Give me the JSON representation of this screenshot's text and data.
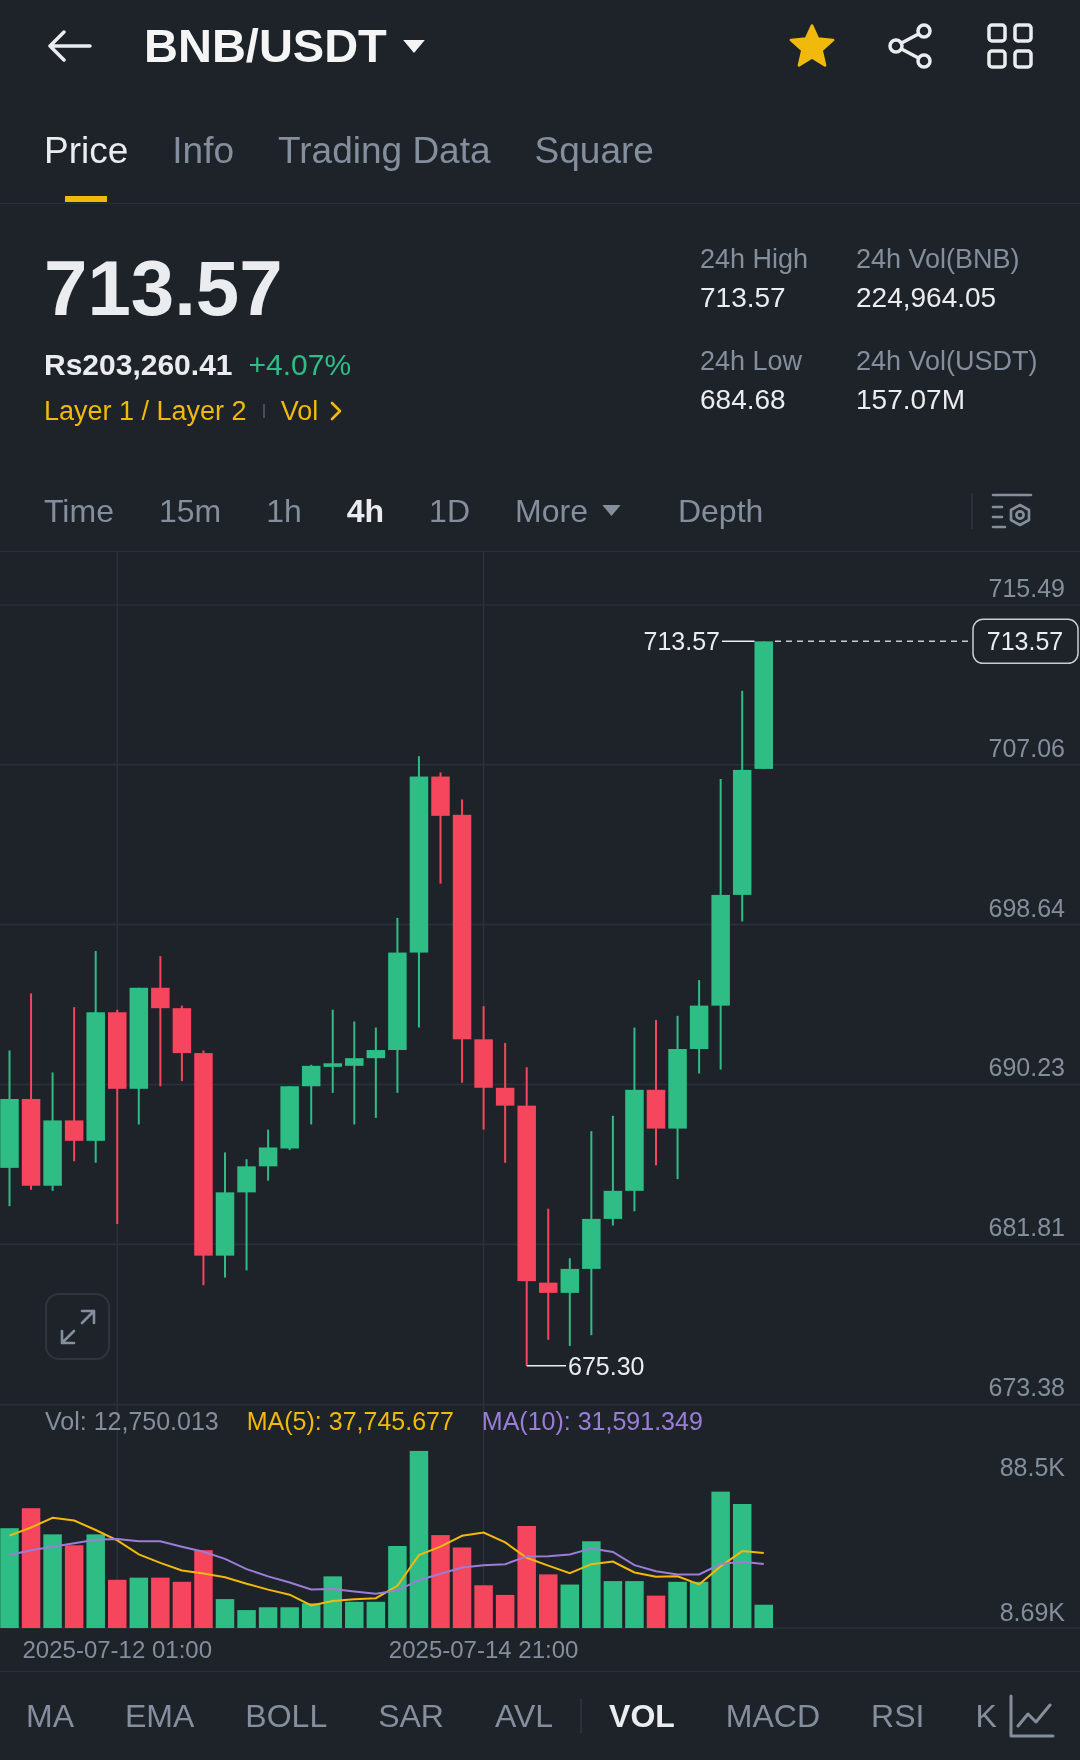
{
  "header": {
    "title": "BNB/USDT",
    "favorite": true
  },
  "tabs": [
    {
      "label": "Price",
      "selected": true
    },
    {
      "label": "Info",
      "selected": false
    },
    {
      "label": "Trading Data",
      "selected": false
    },
    {
      "label": "Square",
      "selected": false
    }
  ],
  "ticker": {
    "price": "713.57",
    "fiat_price": "Rs203,260.41",
    "change": "+4.07%",
    "tags": [
      {
        "label": "Layer 1 / Layer 2",
        "kind": "category"
      },
      {
        "label": "Vol",
        "kind": "link"
      }
    ]
  },
  "stats": [
    {
      "label": "24h High",
      "value": "713.57"
    },
    {
      "label": "24h Vol(BNB)",
      "value": "224,964.05"
    },
    {
      "label": "24h Low",
      "value": "684.68"
    },
    {
      "label": "24h Vol(USDT)",
      "value": "157.07M"
    }
  ],
  "intervals": [
    {
      "label": "Time",
      "kind": "tab",
      "selected": false
    },
    {
      "label": "15m",
      "kind": "tab",
      "selected": false
    },
    {
      "label": "1h",
      "kind": "tab",
      "selected": false
    },
    {
      "label": "4h",
      "kind": "tab",
      "selected": true
    },
    {
      "label": "1D",
      "kind": "tab",
      "selected": false
    },
    {
      "label": "More",
      "kind": "dropdown",
      "selected": false
    },
    {
      "label": "Depth",
      "kind": "tab",
      "selected": false
    }
  ],
  "price_chart": {
    "axis_labels": [
      "715.49",
      "707.06",
      "698.64",
      "690.23",
      "681.81",
      "673.38"
    ],
    "last_price": "713.57",
    "high_label": "713.57",
    "low_label": "675.30"
  },
  "volume_chart": {
    "legend": [
      {
        "label": "Vol: 12,750.013",
        "color": "#848e9c"
      },
      {
        "label": "MA(5): 37,745.677",
        "color": "#f0b90b"
      },
      {
        "label": "MA(10): 31,591.349",
        "color": "#9b7dd8"
      }
    ],
    "chart_data": {
      "type": "bar",
      "ylim": [
        0,
        123200
      ],
      "yticks": [
        {
          "value": 88500,
          "label": "88.5K"
        },
        {
          "value": 8690,
          "label": "8.69K"
        }
      ],
      "categories": [
        null,
        null,
        null,
        null,
        null,
        "2025-07-12 01:00",
        null,
        null,
        null,
        null,
        null,
        null,
        null,
        null,
        null,
        null,
        null,
        null,
        null,
        null,
        null,
        null,
        "2025-07-14 21:00",
        null,
        null,
        null,
        null,
        null,
        null,
        null,
        null,
        null,
        null,
        null,
        null,
        null
      ],
      "series": [
        {
          "type": "bar",
          "colors": [
            "#2ebd85",
            "#f6465d",
            "#2ebd85",
            "#f6465d",
            "#2ebd85",
            "#f6465d",
            "#2ebd85",
            "#f6465d",
            "#f6465d",
            "#f6465d",
            "#2ebd85",
            "#2ebd85",
            "#2ebd85",
            "#2ebd85",
            "#2ebd85",
            "#2ebd85",
            "#2ebd85",
            "#2ebd85",
            "#2ebd85",
            "#2ebd85",
            "#f6465d",
            "#f6465d",
            "#f6465d",
            "#f6465d",
            "#f6465d",
            "#f6465d",
            "#2ebd85",
            "#2ebd85",
            "#2ebd85",
            "#2ebd85",
            "#f6465d",
            "#2ebd85",
            "#2ebd85",
            "#2ebd85",
            "#2ebd85",
            "#2ebd85"
          ],
          "values": [
            54900,
            65900,
            51500,
            45500,
            51500,
            26500,
            27700,
            27700,
            25400,
            42800,
            15900,
            9850,
            11400,
            11400,
            13600,
            28400,
            14400,
            14400,
            45100,
            97400,
            51100,
            44300,
            23500,
            18200,
            56100,
            29500,
            23900,
            47700,
            25800,
            25800,
            17800,
            25400,
            25400,
            75000,
            68200,
            12800
          ]
        },
        {
          "type": "line",
          "color": "#f0b90b",
          "values": [
            50800,
            55300,
            60600,
            59100,
            53900,
            48200,
            40500,
            35800,
            31700,
            30000,
            27900,
            24300,
            21100,
            18300,
            12400,
            14900,
            15800,
            16400,
            23200,
            40100,
            44700,
            50700,
            52500,
            47100,
            38600,
            34300,
            30200,
            35100,
            36600,
            30500,
            28200,
            28500,
            24000,
            33900,
            42300,
            41300
          ]
        },
        {
          "type": "line",
          "color": "#9b7dd8",
          "values": [
            40200,
            42800,
            44700,
            46600,
            48500,
            48900,
            47700,
            47700,
            44700,
            41900,
            38000,
            32400,
            28400,
            25000,
            21200,
            21400,
            20100,
            18800,
            20700,
            26300,
            29800,
            33200,
            34500,
            35100,
            39400,
            39500,
            40400,
            43800,
            41800,
            34600,
            31200,
            29400,
            29500,
            35200,
            36400,
            35200
          ]
        }
      ]
    }
  },
  "indicators": {
    "main": [
      {
        "label": "MA",
        "selected": false
      },
      {
        "label": "EMA",
        "selected": false
      },
      {
        "label": "BOLL",
        "selected": false
      },
      {
        "label": "SAR",
        "selected": false
      },
      {
        "label": "AVL",
        "selected": false
      }
    ],
    "sub": [
      {
        "label": "VOL",
        "selected": true
      },
      {
        "label": "MACD",
        "selected": false
      },
      {
        "label": "RSI",
        "selected": false
      },
      {
        "label": "K",
        "selected": false
      }
    ]
  }
}
